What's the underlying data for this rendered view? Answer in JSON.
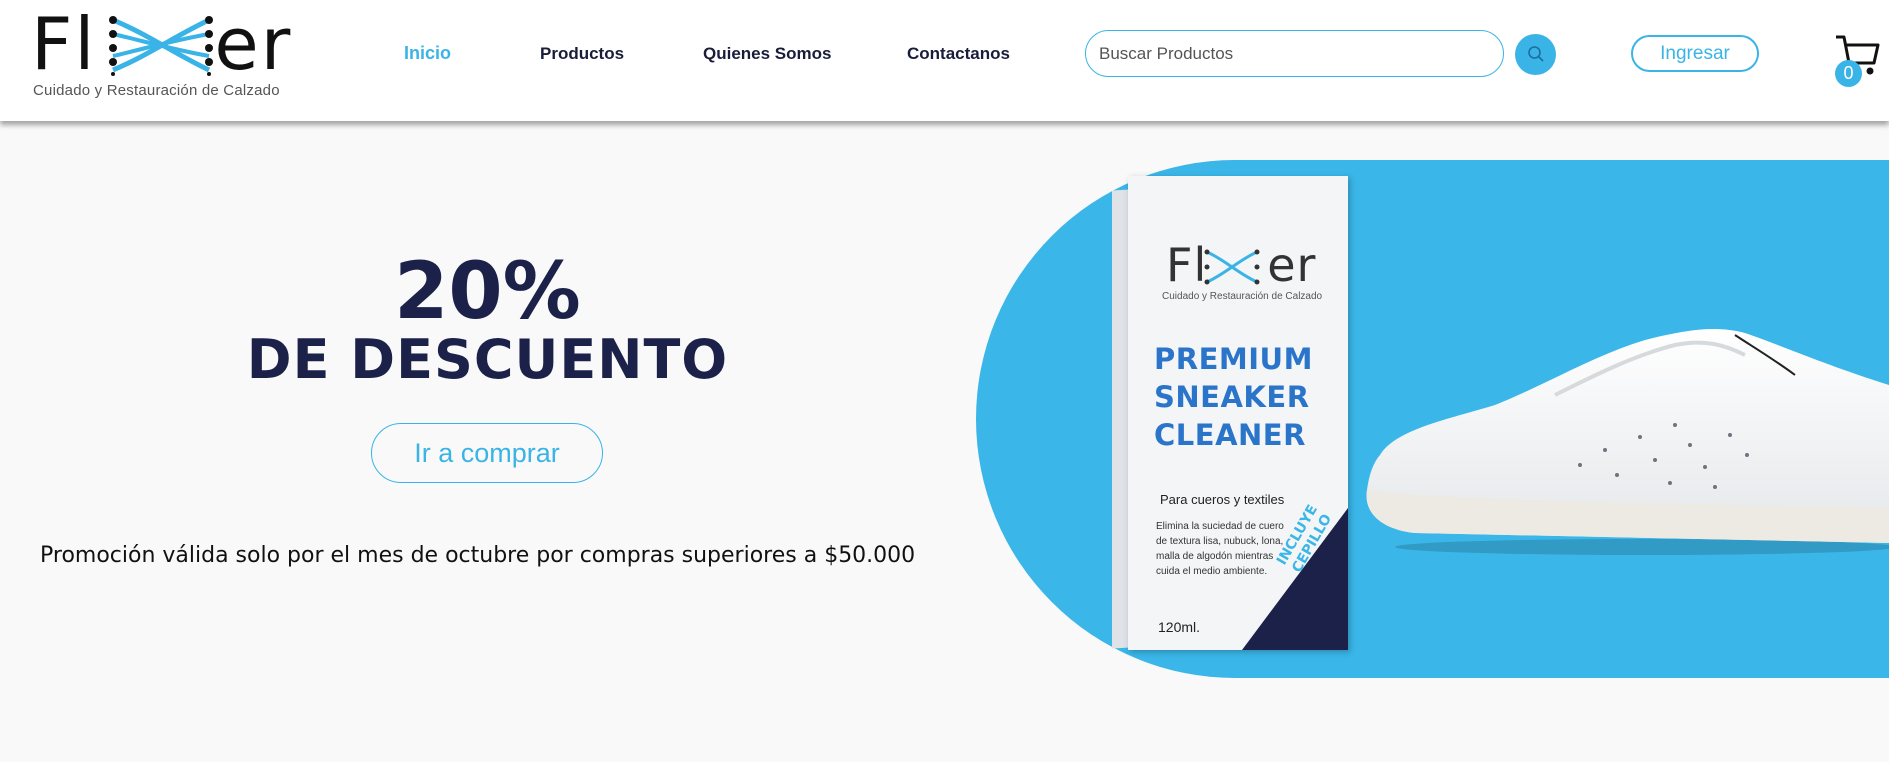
{
  "header": {
    "logo": {
      "wordmark": "Fixer",
      "tagline": "Cuidado y Restauración de Calzado"
    },
    "nav": [
      {
        "label": "Inicio",
        "active": true
      },
      {
        "label": "Productos",
        "active": false
      },
      {
        "label": "Quienes Somos",
        "active": false
      },
      {
        "label": "Contactanos",
        "active": false
      }
    ],
    "search": {
      "placeholder": "Buscar Productos",
      "value": "",
      "icon": "search-icon"
    },
    "login_label": "Ingresar",
    "cart": {
      "icon": "cart-icon",
      "count": "0"
    }
  },
  "hero": {
    "discount": "20%",
    "discount_label": "DE DESCUENTO",
    "cta_label": "Ir a comprar",
    "note": "Promoción válida solo por el mes de octubre por compras superiores a $50.000",
    "product_box": {
      "brand": "Fixer",
      "brand_tagline": "Cuidado y Restauración de Calzado",
      "title_line1": "PREMIUM",
      "title_line2": "SNEAKER",
      "title_line3": "CLEANER",
      "subtitle": "Para cueros y textiles",
      "description": "Elimina la suciedad de cuero de textura lisa, nubuck, lona, malla de algodón mientras cuida el medio ambiente.",
      "volume": "120ml.",
      "badge": "INCLUYE CEPILLO"
    }
  },
  "colors": {
    "accent": "#3ab4e6",
    "navy": "#1b2149",
    "hero_bg": "#3ab6e8"
  }
}
